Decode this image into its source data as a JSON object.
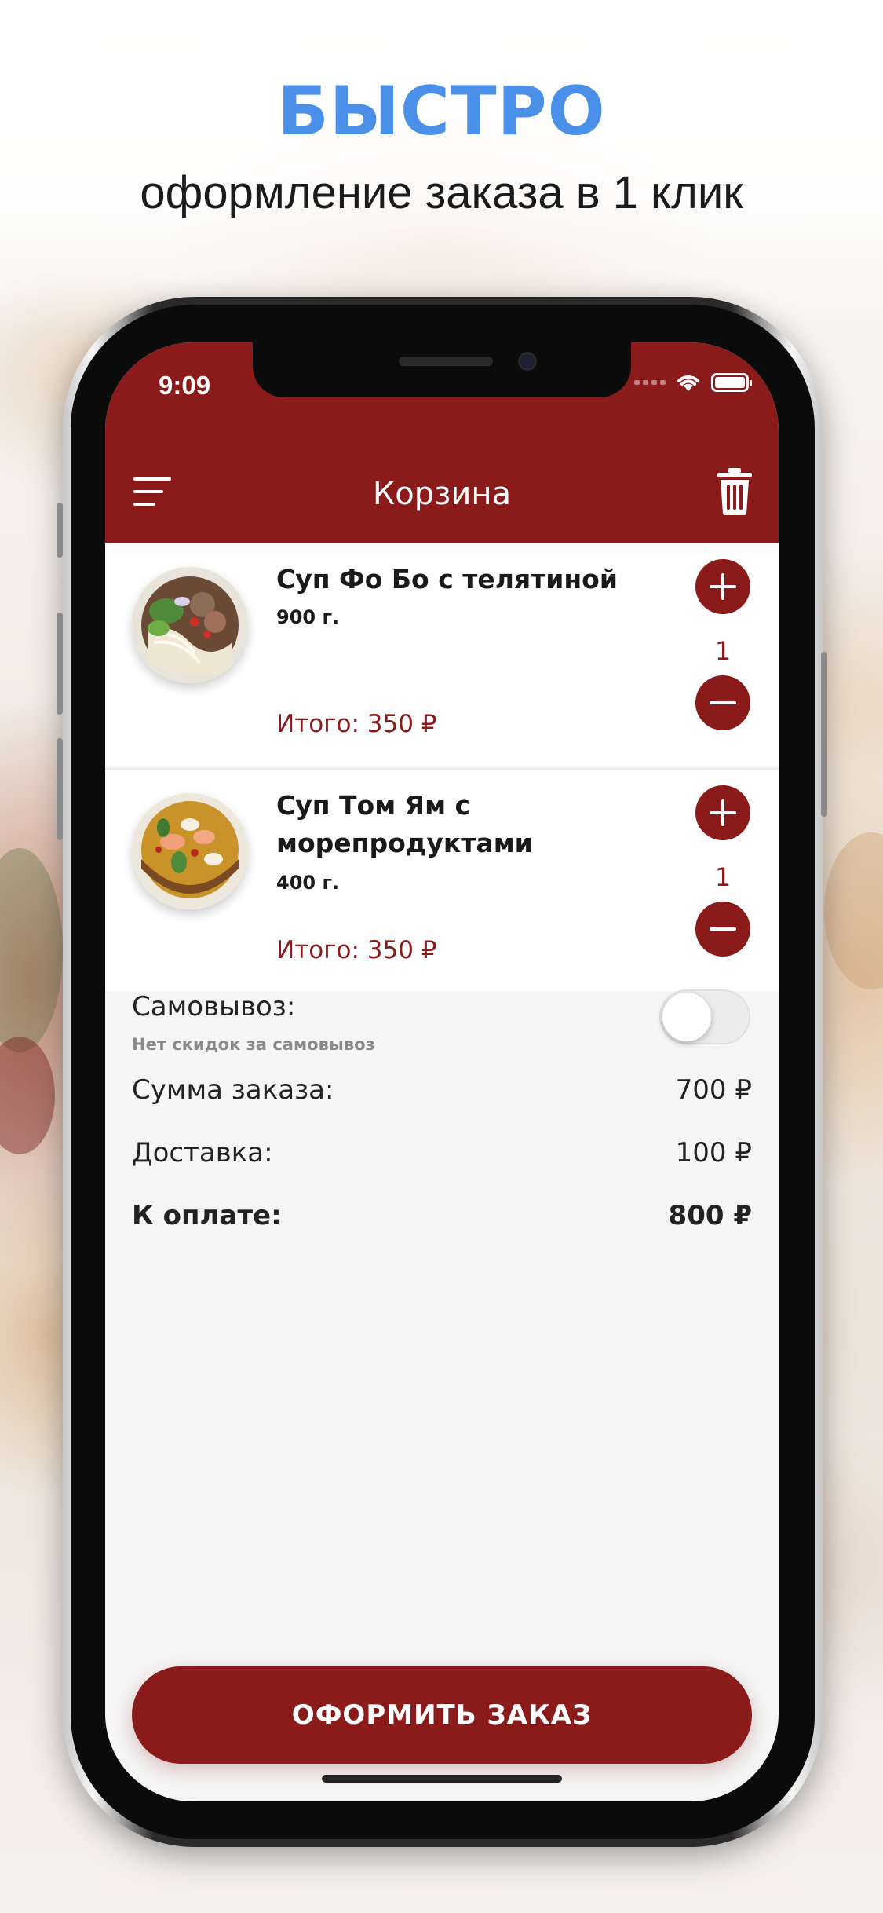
{
  "promo": {
    "headline": "БЫСТРО",
    "subline": "оформление заказа в 1 клик"
  },
  "status_bar": {
    "time": "9:09"
  },
  "nav": {
    "title": "Корзина",
    "menu_icon": "hamburger-icon",
    "trash_icon": "trash-icon"
  },
  "cart": {
    "items": [
      {
        "name": "Суп Фо Бо с телятиной",
        "weight": "900 г.",
        "quantity": "1",
        "total": "Итого: 350 ₽"
      },
      {
        "name": "Суп Том Ям с морепродуктами",
        "weight": "400 г.",
        "quantity": "1",
        "total": "Итого: 350 ₽"
      }
    ]
  },
  "summary": {
    "pickup_label": "Самовывоз:",
    "pickup_note": "Нет скидок за самовывоз",
    "pickup_enabled": false,
    "order_sum_label": "Сумма заказа:",
    "order_sum_value": "700 ₽",
    "delivery_label": "Доставка:",
    "delivery_value": "100 ₽",
    "to_pay_label": "К оплате:",
    "to_pay_value": "800 ₽"
  },
  "checkout_button": "ОФОРМИТЬ ЗАКАЗ",
  "colors": {
    "accent": "#8b1a1a",
    "headline_blue": "#4a90e8"
  }
}
